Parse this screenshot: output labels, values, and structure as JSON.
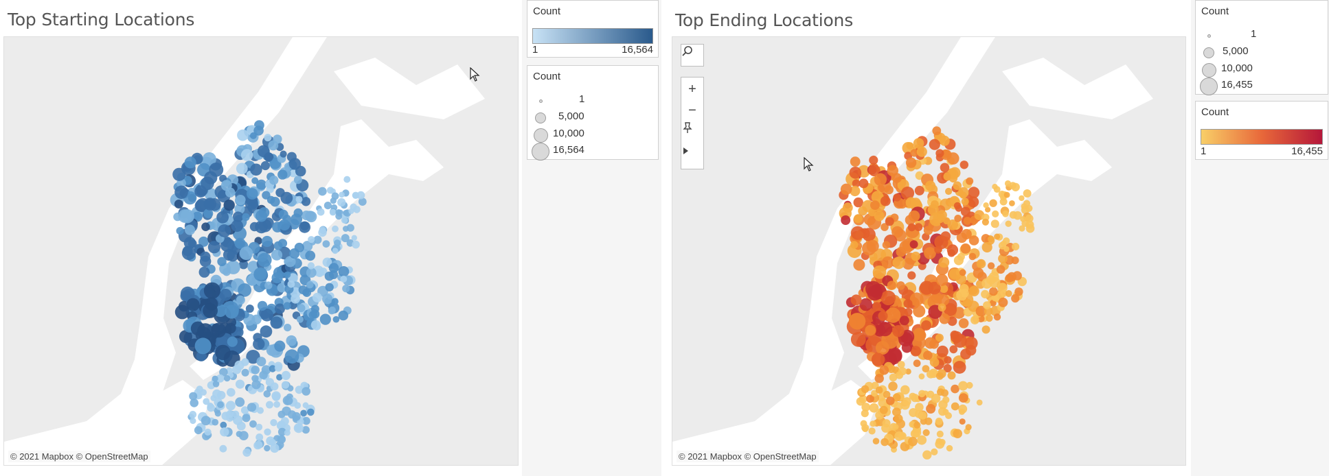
{
  "left_panel": {
    "title": "Top Starting Locations",
    "credit": "© 2021 Mapbox © OpenStreetMap",
    "color_legend": {
      "title": "Count",
      "min": "1",
      "max": "16,564",
      "color_low": "#c8e2f5",
      "color_high": "#2a5a8c"
    },
    "size_legend": {
      "title": "Count",
      "items": [
        "1",
        "5,000",
        "10,000",
        "16,564"
      ]
    }
  },
  "right_panel": {
    "title": "Top Ending Locations",
    "credit": "© 2021 Mapbox © OpenStreetMap",
    "size_legend": {
      "title": "Count",
      "items": [
        "1",
        "5,000",
        "10,000",
        "16,455"
      ]
    },
    "color_legend": {
      "title": "Count",
      "min": "1",
      "max": "16,455",
      "color_low": "#f8cf68",
      "color_high": "#b5173a"
    },
    "toolbar": {
      "items": [
        "search-icon",
        "zoom-in-icon",
        "zoom-out-icon",
        "pin-icon",
        "play-icon"
      ]
    }
  },
  "colors": {
    "map_land": "#ececec",
    "map_water": "#ffffff",
    "blue_scale": [
      "#a9d0ee",
      "#7ab0dc",
      "#5090c6",
      "#3a6fa7",
      "#264f82"
    ],
    "orange_scale": [
      "#f9c35c",
      "#f5a83e",
      "#ef8532",
      "#e35f2b",
      "#c22c32"
    ]
  }
}
